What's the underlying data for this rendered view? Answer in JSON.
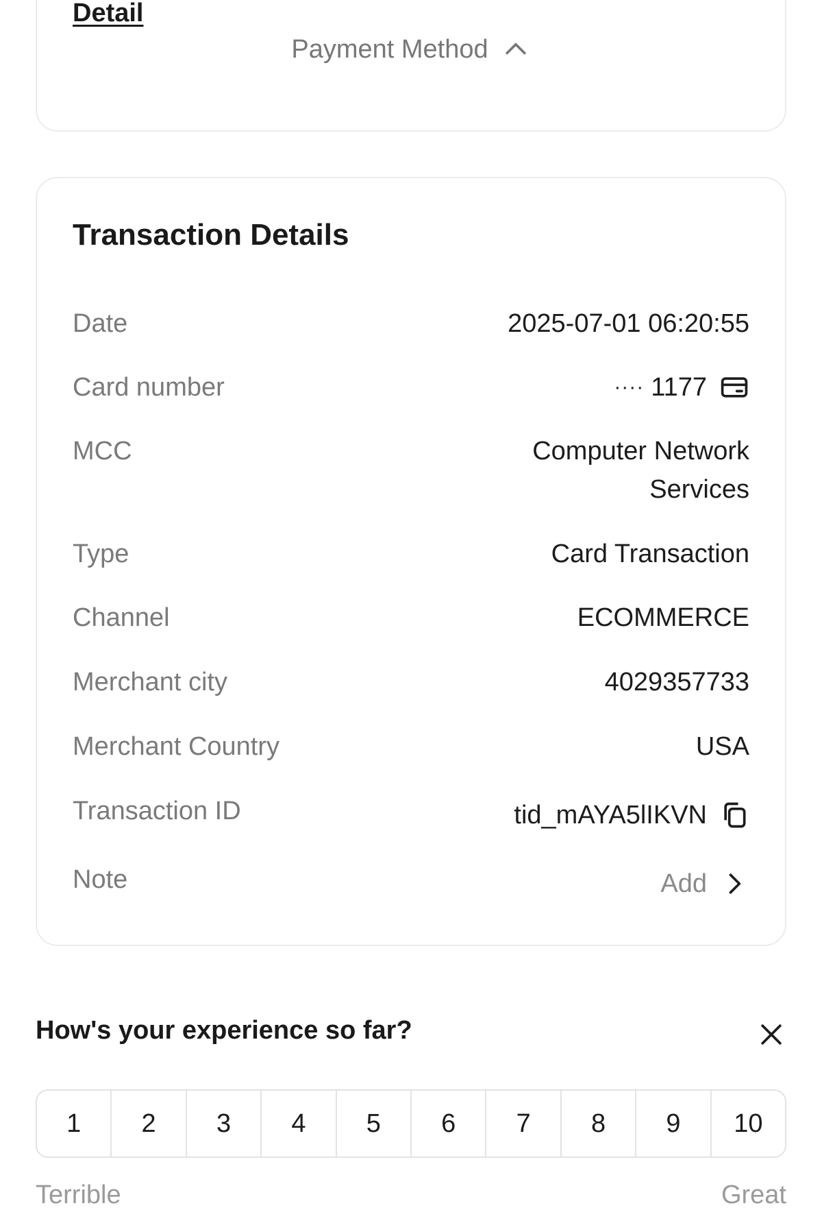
{
  "top_card": {
    "detail_link": "Detail",
    "payment_method_toggle": "Payment Method"
  },
  "transaction": {
    "title": "Transaction Details",
    "rows": {
      "date": {
        "label": "Date",
        "value": "2025-07-01 06:20:55"
      },
      "card_number": {
        "label": "Card number",
        "masked": "····",
        "last4": "1177"
      },
      "mcc": {
        "label": "MCC",
        "value": "Computer Network Services"
      },
      "type": {
        "label": "Type",
        "value": "Card Transaction"
      },
      "channel": {
        "label": "Channel",
        "value": "ECOMMERCE"
      },
      "merchant_city": {
        "label": "Merchant city",
        "value": "4029357733"
      },
      "merchant_country": {
        "label": "Merchant Country",
        "value": "USA"
      },
      "transaction_id": {
        "label": "Transaction ID",
        "value": "tid_mAYA5lIKVN"
      },
      "note": {
        "label": "Note",
        "action": "Add"
      }
    }
  },
  "feedback": {
    "question": "How's your experience so far?",
    "scale": [
      "1",
      "2",
      "3",
      "4",
      "5",
      "6",
      "7",
      "8",
      "9",
      "10"
    ],
    "low_label": "Terrible",
    "high_label": "Great"
  },
  "icons": {
    "payment_toggle": "chevron-up-icon",
    "card": "card-icon",
    "copy": "copy-icon",
    "note": "chevron-right-icon",
    "close": "close-icon"
  }
}
